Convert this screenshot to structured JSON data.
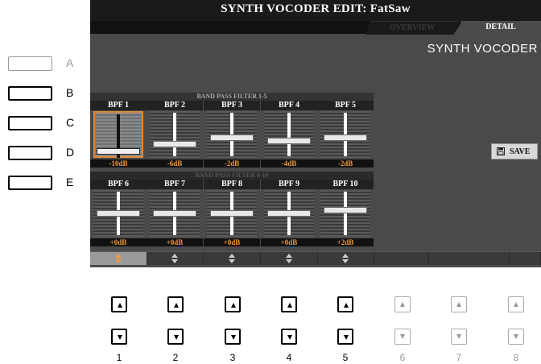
{
  "header": {
    "title": "SYNTH VOCODER EDIT: FatSaw"
  },
  "tabs": [
    {
      "label": "OVERVIEW",
      "active": false
    },
    {
      "label": "DETAIL",
      "active": true
    }
  ],
  "subtitle": "SYNTH VOCODER",
  "side_buttons": [
    {
      "letter": "A",
      "enabled": false
    },
    {
      "letter": "B",
      "enabled": true
    },
    {
      "letter": "C",
      "enabled": true
    },
    {
      "letter": "D",
      "enabled": true
    },
    {
      "letter": "E",
      "enabled": true
    }
  ],
  "filters": {
    "group1_title": "BAND PASS FILTER 1-5",
    "group2_title": "BAND PASS FILTER 6-10",
    "bands": [
      {
        "label": "BPF 1",
        "value": "-10dB",
        "level_db": -10,
        "selected": true
      },
      {
        "label": "BPF 2",
        "value": "-6dB",
        "level_db": -6,
        "selected": false
      },
      {
        "label": "BPF 3",
        "value": "-2dB",
        "level_db": -2,
        "selected": false
      },
      {
        "label": "BPF 4",
        "value": "-4dB",
        "level_db": -4,
        "selected": false
      },
      {
        "label": "BPF 5",
        "value": "-2dB",
        "level_db": -2,
        "selected": false
      },
      {
        "label": "BPF 6",
        "value": "+0dB",
        "level_db": 0,
        "selected": false
      },
      {
        "label": "BPF 7",
        "value": "+0dB",
        "level_db": 0,
        "selected": false
      },
      {
        "label": "BPF 8",
        "value": "+0dB",
        "level_db": 0,
        "selected": false
      },
      {
        "label": "BPF 9",
        "value": "+0dB",
        "level_db": 0,
        "selected": false
      },
      {
        "label": "BPF 10",
        "value": "+2dB",
        "level_db": 2,
        "selected": false
      }
    ]
  },
  "save_label": "SAVE",
  "bottom_buttons": [
    {
      "number": "1",
      "enabled": true
    },
    {
      "number": "2",
      "enabled": true
    },
    {
      "number": "3",
      "enabled": true
    },
    {
      "number": "4",
      "enabled": true
    },
    {
      "number": "5",
      "enabled": true
    },
    {
      "number": "6",
      "enabled": false
    },
    {
      "number": "7",
      "enabled": false
    },
    {
      "number": "8",
      "enabled": false
    }
  ],
  "colors": {
    "accent": "#f29a3a",
    "screen_bg": "#4a4a4a",
    "selection": "#e08b3a"
  }
}
